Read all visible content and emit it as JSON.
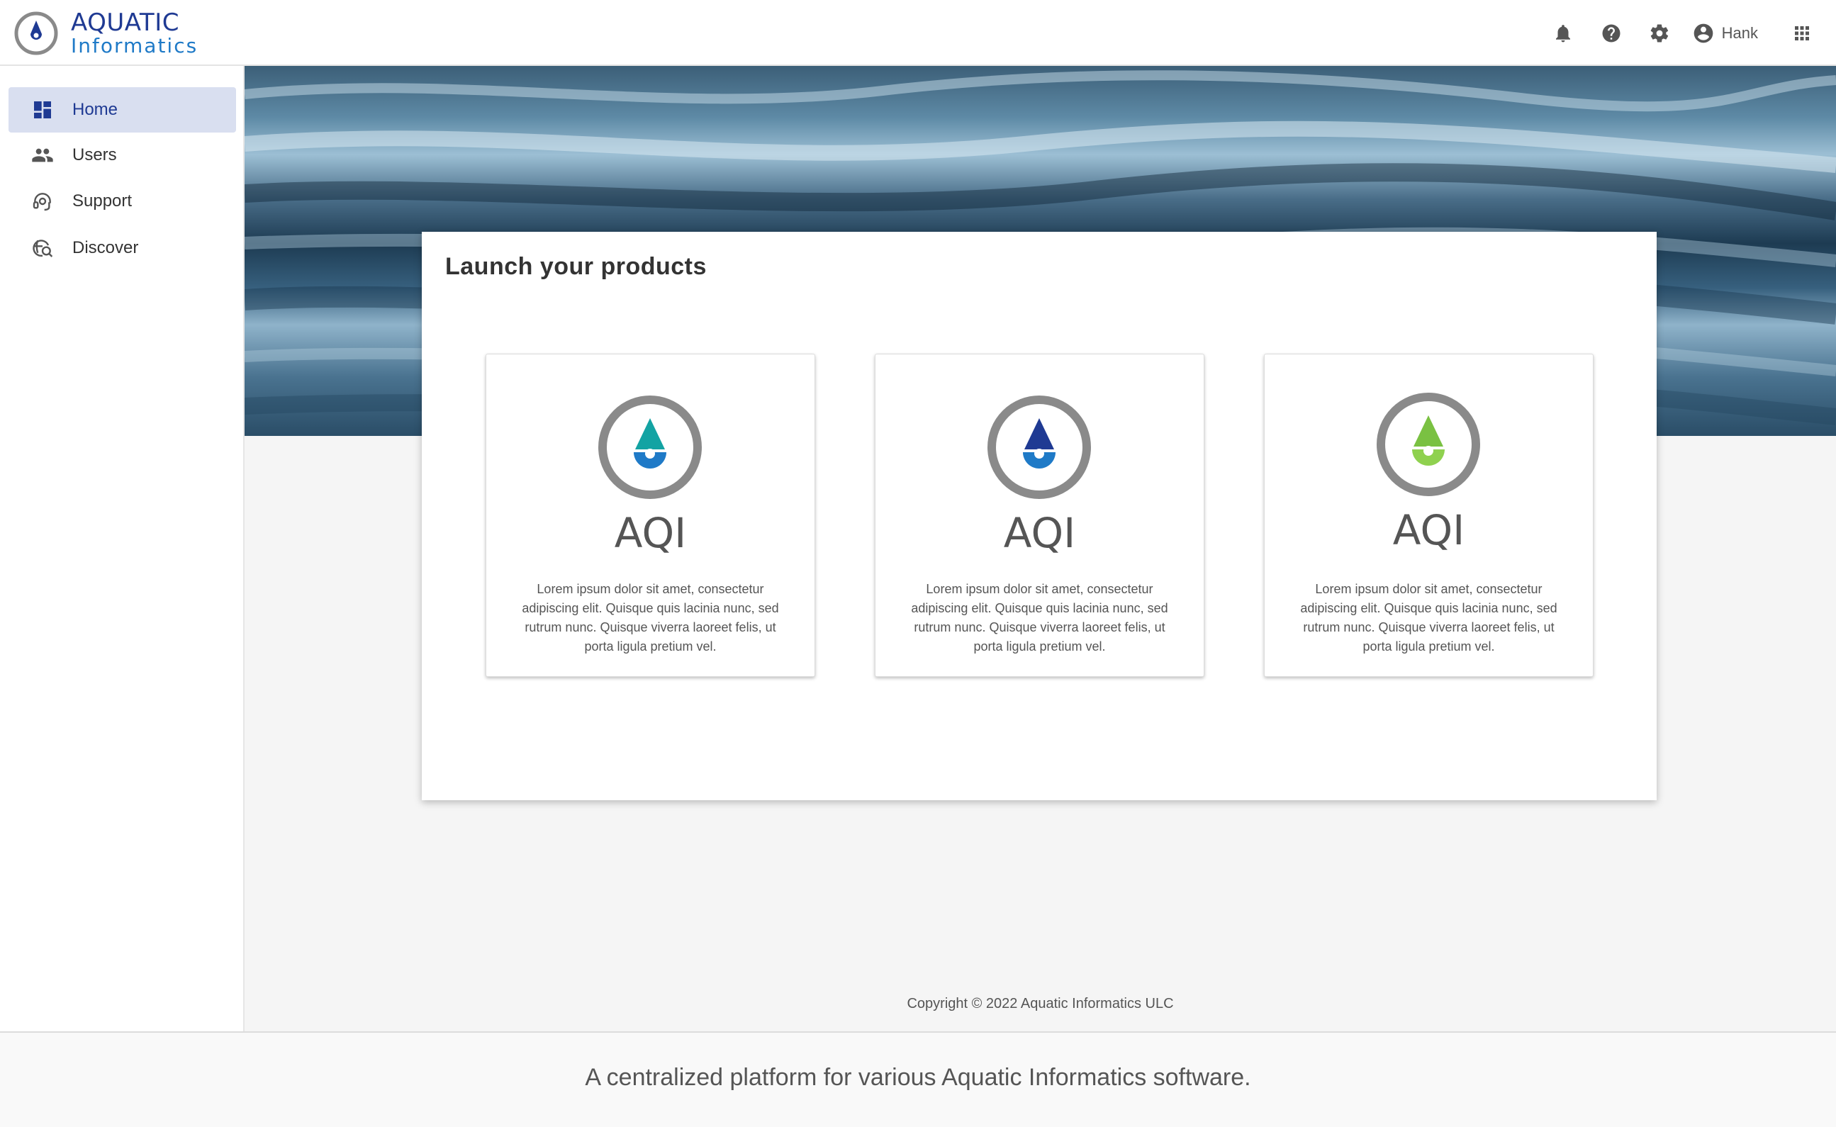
{
  "brand": {
    "line1": "AQUATIC",
    "line2": "Informatics"
  },
  "header": {
    "icons": [
      "bell-icon",
      "help-icon",
      "gear-icon",
      "account-icon",
      "apps-grid-icon"
    ],
    "user_name": "Hank"
  },
  "sidebar": {
    "items": [
      {
        "label": "Home",
        "icon": "dashboard-icon",
        "active": true
      },
      {
        "label": "Users",
        "icon": "users-icon",
        "active": false
      },
      {
        "label": "Support",
        "icon": "support-icon",
        "active": false
      },
      {
        "label": "Discover",
        "icon": "discover-icon",
        "active": false
      }
    ]
  },
  "main": {
    "title": "Launch your products",
    "products": [
      {
        "name": "AQI",
        "accent": "#13a3a3",
        "description": "Lorem ipsum dolor sit amet, consectetur adipiscing elit. Quisque quis lacinia nunc, sed rutrum nunc. Quisque viverra laoreet felis, ut porta ligula pretium vel."
      },
      {
        "name": "AQI",
        "accent": "#1f3a93",
        "description": "Lorem ipsum dolor sit amet, consectetur adipiscing elit. Quisque quis lacinia nunc, sed rutrum nunc. Quisque viverra laoreet felis, ut porta ligula pretium vel."
      },
      {
        "name": "AQI",
        "accent": "#7ac142",
        "description": "Lorem ipsum dolor sit amet, consectetur adipiscing elit. Quisque quis lacinia nunc, sed rutrum nunc. Quisque viverra laoreet felis, ut porta ligula pretium vel."
      }
    ]
  },
  "copyright": "Copyright © 2022 Aquatic Informatics ULC",
  "footer": {
    "tagline": "A centralized platform for various Aquatic Informatics software."
  },
  "colors": {
    "primary": "#1f3a93",
    "secondary": "#1f7ac7",
    "active_nav_bg": "#d9dff0",
    "ring_gray": "#8a8a8a"
  }
}
